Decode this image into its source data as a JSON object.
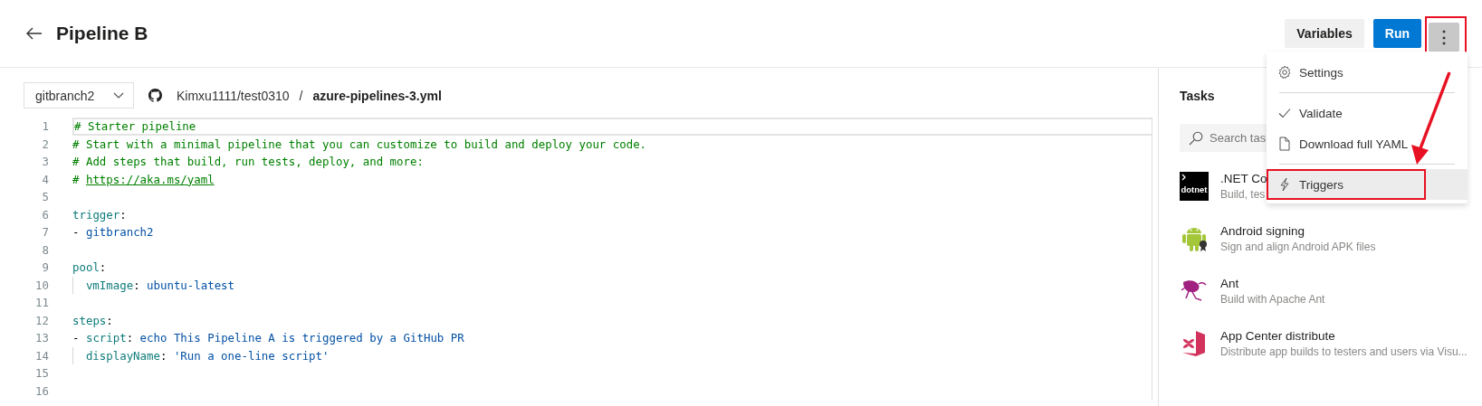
{
  "header": {
    "back_icon": true,
    "title": "Pipeline B",
    "buttons": [
      {
        "label": "Variables",
        "kind": "secondary"
      },
      {
        "label": "Run",
        "kind": "primary"
      }
    ],
    "more_button": {
      "label": "⋮",
      "pressed": true,
      "outlined": true
    }
  },
  "editor": {
    "branch": "gitbranch2",
    "repository": "Kimxu1111/test0310",
    "separator": "/",
    "file": "azure-pipelines-3.yml",
    "lines": [
      {
        "number": "1",
        "current": true,
        "indented": false,
        "tokens": [
          {
            "kind": "comment",
            "text": "# Starter pipeline"
          }
        ]
      },
      {
        "number": "2",
        "current": false,
        "indented": false,
        "tokens": [
          {
            "kind": "comment",
            "text": "# Start with a minimal pipeline that you can customize to build and deploy your code."
          }
        ]
      },
      {
        "number": "3",
        "current": false,
        "indented": false,
        "tokens": [
          {
            "kind": "comment",
            "text": "# Add steps that build, run tests, deploy, and more:"
          }
        ]
      },
      {
        "number": "4",
        "current": false,
        "indented": false,
        "tokens": [
          {
            "kind": "comment",
            "text": "# "
          },
          {
            "kind": "link",
            "text": "https://aka.ms/yaml"
          }
        ]
      },
      {
        "number": "5",
        "current": false,
        "indented": false
      },
      {
        "number": "6",
        "current": false,
        "indented": false,
        "tokens": [
          {
            "kind": "key",
            "text": "trigger"
          },
          {
            "kind": "punct",
            "text": ":"
          }
        ]
      },
      {
        "number": "7",
        "current": false,
        "indented": false,
        "tokens": [
          {
            "kind": "punct",
            "text": "- "
          },
          {
            "kind": "value",
            "text": "gitbranch2"
          }
        ]
      },
      {
        "number": "8",
        "current": false,
        "indented": false
      },
      {
        "number": "9",
        "current": false,
        "indented": false,
        "tokens": [
          {
            "kind": "key",
            "text": "pool"
          },
          {
            "kind": "punct",
            "text": ":"
          }
        ]
      },
      {
        "number": "10",
        "current": false,
        "indented": true,
        "tokens": [
          {
            "kind": "key",
            "text": "vmImage"
          },
          {
            "kind": "punct",
            "text": ": "
          },
          {
            "kind": "value",
            "text": "ubuntu-latest"
          }
        ]
      },
      {
        "number": "11",
        "current": false,
        "indented": false
      },
      {
        "number": "12",
        "current": false,
        "indented": false,
        "tokens": [
          {
            "kind": "key",
            "text": "steps"
          },
          {
            "kind": "punct",
            "text": ":"
          }
        ]
      },
      {
        "number": "13",
        "current": false,
        "indented": false,
        "tokens": [
          {
            "kind": "punct",
            "text": "- "
          },
          {
            "kind": "key",
            "text": "script"
          },
          {
            "kind": "punct",
            "text": ": "
          },
          {
            "kind": "value",
            "text": "echo This Pipeline A is triggered by a GitHub PR"
          }
        ]
      },
      {
        "number": "14",
        "current": false,
        "indented": true,
        "tokens": [
          {
            "kind": "key",
            "text": "displayName"
          },
          {
            "kind": "punct",
            "text": ": "
          },
          {
            "kind": "value",
            "text": "'Run a one-line script'"
          }
        ]
      },
      {
        "number": "15",
        "current": false,
        "indented": false
      },
      {
        "number": "16",
        "current": false,
        "indented": false
      }
    ]
  },
  "tasks_panel": {
    "title": "Tasks",
    "search": {
      "placeholder": "Search tas"
    },
    "tasks": [
      {
        "title": ".NET Co",
        "description": "Build, tes",
        "logo_text": "dotnet"
      },
      {
        "title": "Android signing",
        "description": "Sign and align Android APK files"
      },
      {
        "title": "Ant",
        "description": "Build with Apache Ant"
      },
      {
        "title": "App Center distribute",
        "description": "Distribute app builds to testers and users via Visu..."
      }
    ]
  },
  "menu": {
    "items": [
      {
        "kind": "item",
        "label": "Settings",
        "hovered": false,
        "outlined": false
      },
      {
        "kind": "divider"
      },
      {
        "kind": "item",
        "label": "Validate",
        "hovered": false,
        "outlined": false
      },
      {
        "kind": "item",
        "label": "Download full YAML",
        "hovered": false,
        "outlined": false
      },
      {
        "kind": "divider"
      },
      {
        "kind": "item",
        "label": "Triggers",
        "hovered": true,
        "outlined": true
      }
    ]
  },
  "annotation_arrow": true
}
